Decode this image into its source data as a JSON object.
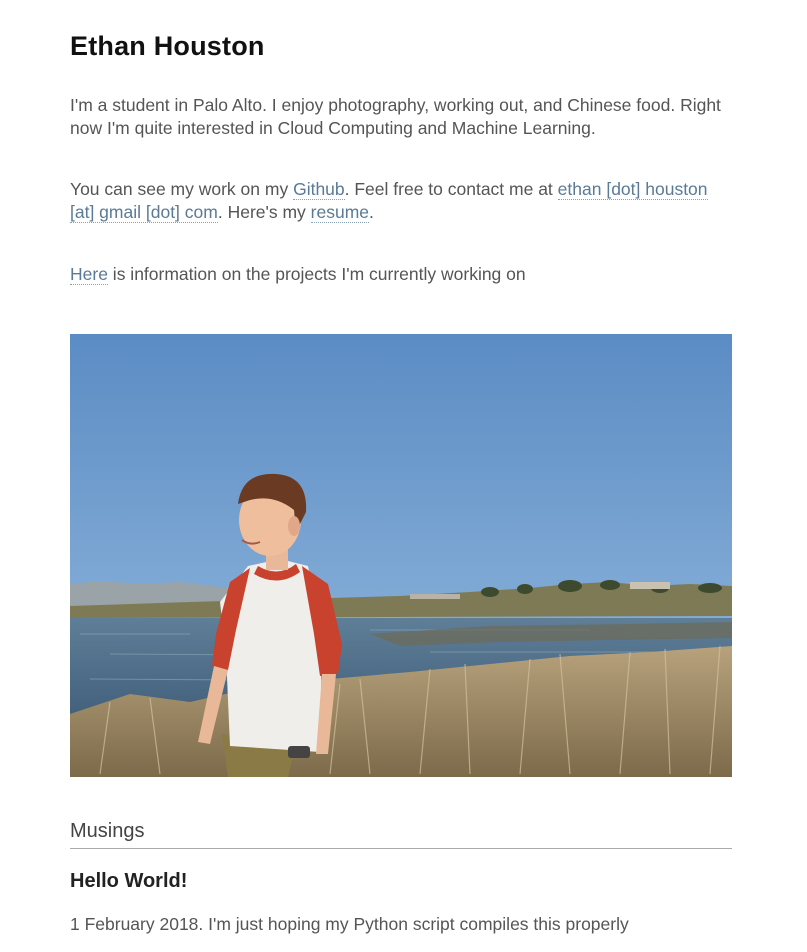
{
  "header": {
    "name": "Ethan Houston"
  },
  "intro": {
    "text": "I'm a student in Palo Alto. I enjoy photography, working out, and Chinese food. Right now I'm quite interested in Cloud Computing and Machine Learning."
  },
  "contact": {
    "prefix": "You can see my work on my ",
    "github_label": "Github",
    "middle": ". Feel free to contact me at ",
    "email_label": "ethan [dot] houston [at] gmail [dot] com",
    "resume_prefix": ". Here's my ",
    "resume_label": "resume",
    "suffix": "."
  },
  "projects": {
    "link_label": "Here",
    "text": " is information on the projects I'm currently working on"
  },
  "photo": {
    "alt": "Ethan Houston"
  },
  "musings": {
    "heading": "Musings",
    "posts": [
      {
        "title": "Hello World!",
        "snippet": "1 February 2018. I'm just hoping my Python script compiles this properly"
      }
    ]
  },
  "colors": {
    "link": "#5a7a96",
    "text": "#555555",
    "heading": "#111111"
  }
}
